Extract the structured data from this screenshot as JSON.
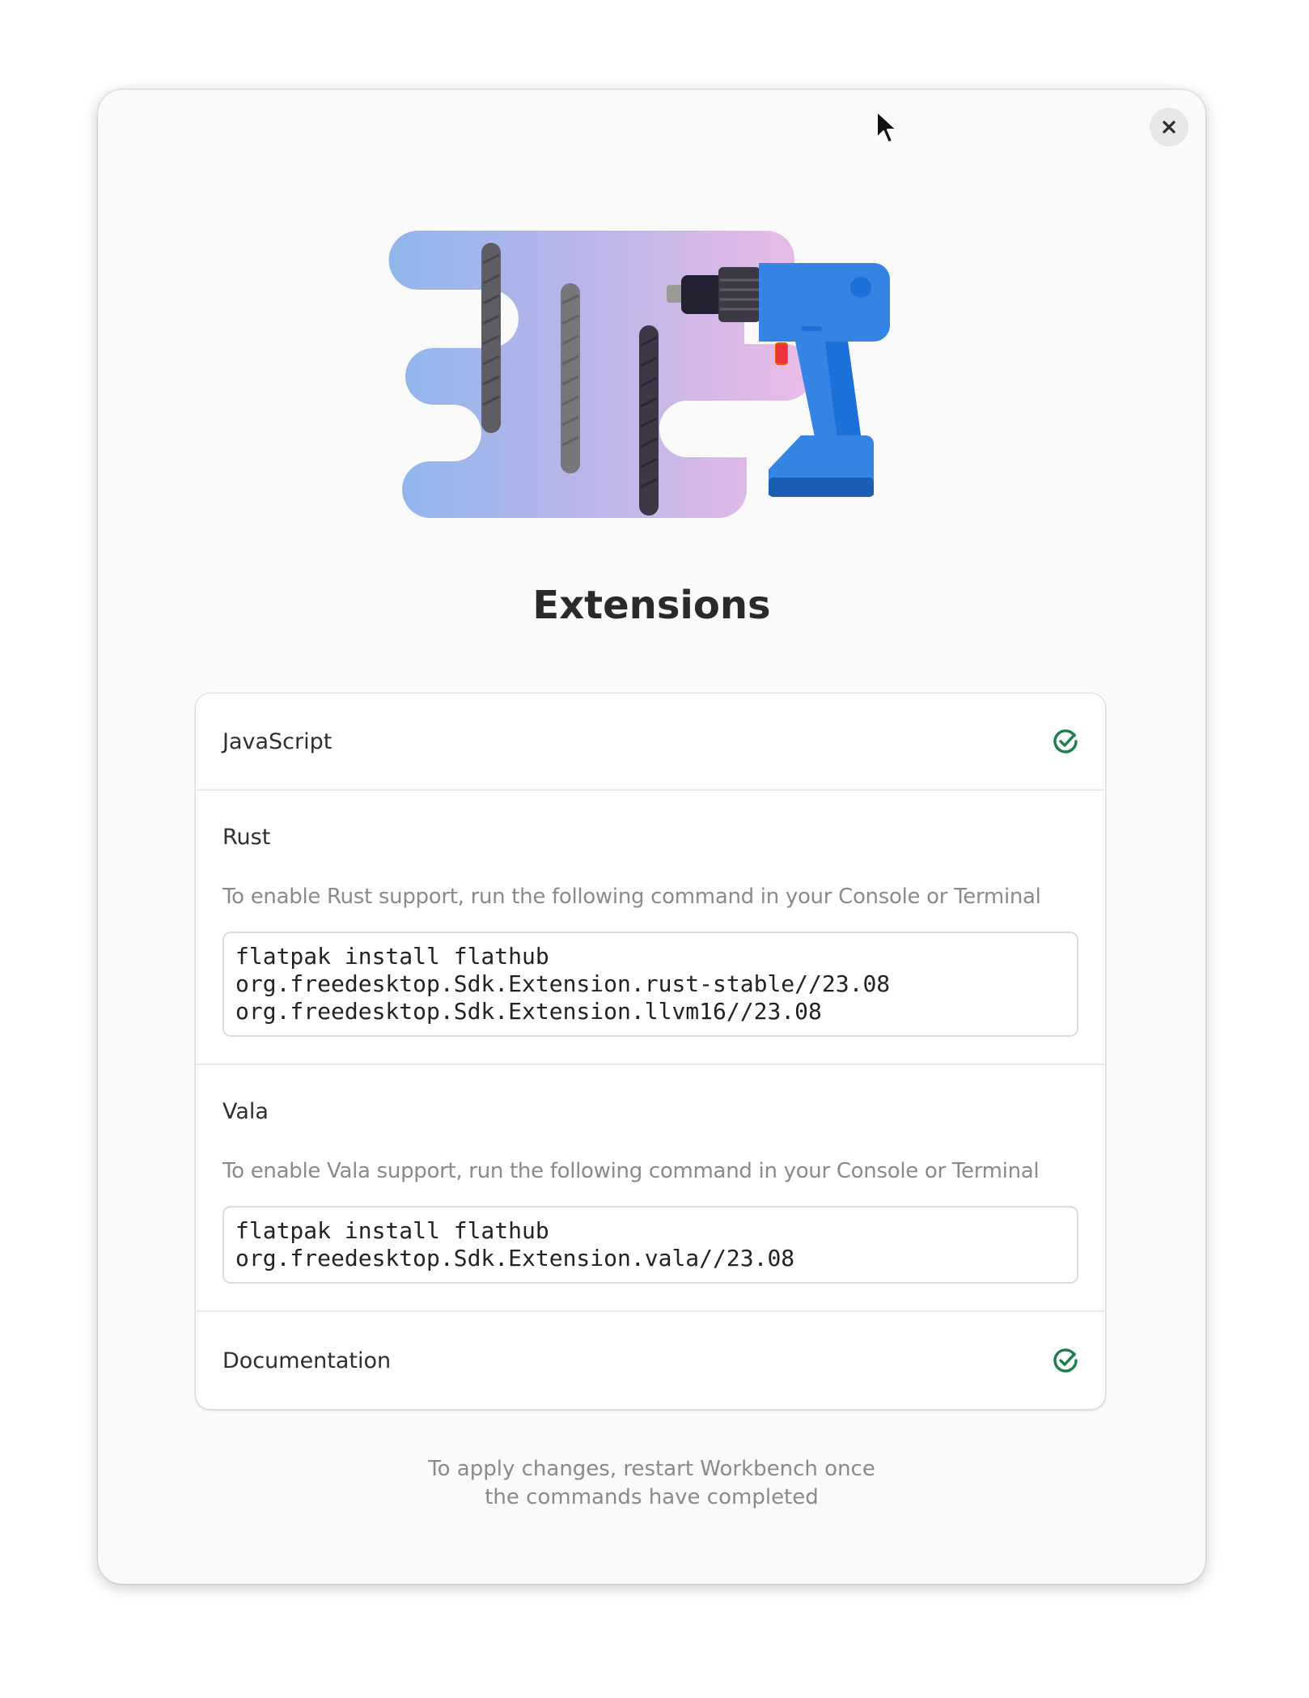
{
  "dialog": {
    "title": "Extensions",
    "close_icon": "close-icon",
    "footer_line1": "To apply changes, restart Workbench once",
    "footer_line2": "the commands have completed"
  },
  "extensions": [
    {
      "label": "JavaScript",
      "status": "installed",
      "status_icon": "check-circle-icon"
    },
    {
      "label": "Rust",
      "description": "To enable Rust support, run the following command in your Console or Terminal",
      "command": "flatpak install flathub\norg.freedesktop.Sdk.Extension.rust-stable//23.08\norg.freedesktop.Sdk.Extension.llvm16//23.08"
    },
    {
      "label": "Vala",
      "description": "To enable Vala support, run the following command in your Console or Terminal",
      "command": "flatpak install flathub\norg.freedesktop.Sdk.Extension.vala//23.08"
    },
    {
      "label": "Documentation",
      "status": "installed",
      "status_icon": "check-circle-icon"
    }
  ],
  "colors": {
    "success": "#1a7f4b",
    "accent_blue": "#3584e4"
  }
}
